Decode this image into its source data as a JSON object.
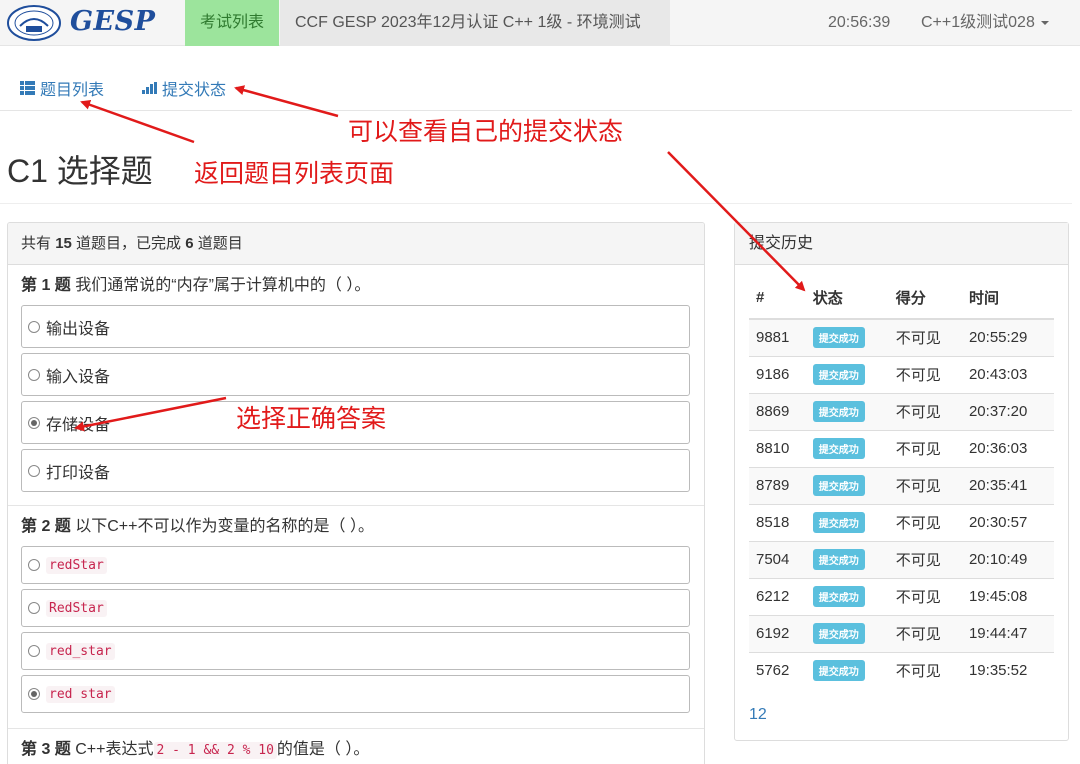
{
  "navbar": {
    "brand": "GESP",
    "exam_list": "考试列表",
    "exam_title": "CCF GESP 2023年12月认证 C++ 1级 - 环境测试",
    "clock": "20:56:39",
    "user": "C++1级测试028"
  },
  "subnav": {
    "problem_list": "题目列表",
    "submit_status": "提交状态"
  },
  "page_title": "C1 选择题",
  "left_panel": {
    "summary_prefix": "共有",
    "total": "15",
    "summary_mid": "道题目，已完成",
    "done": "6",
    "summary_suffix": "道题目"
  },
  "questions": [
    {
      "no_prefix": "第 1 题",
      "text": "我们通常说的“内存”属于计算机中的（ ）。",
      "options": [
        "输出设备",
        "输入设备",
        "存储设备",
        "打印设备"
      ],
      "selected": 2
    },
    {
      "no_prefix": "第 2 题",
      "text": "以下C++不可以作为变量的名称的是（ ）。",
      "options": [
        "redStar",
        "RedStar",
        "red_star",
        "red star"
      ],
      "selected": 3
    },
    {
      "no_prefix": "第 3 题",
      "text_before": "C++表达式",
      "code": "2 - 1 && 2 % 10",
      "text_after": "的值是（ ）。"
    }
  ],
  "history": {
    "title": "提交历史",
    "columns": [
      "#",
      "状态",
      "得分",
      "时间"
    ],
    "rows": [
      {
        "id": "9881",
        "status": "提交成功",
        "score": "不可见",
        "time": "20:55:29"
      },
      {
        "id": "9186",
        "status": "提交成功",
        "score": "不可见",
        "time": "20:43:03"
      },
      {
        "id": "8869",
        "status": "提交成功",
        "score": "不可见",
        "time": "20:37:20"
      },
      {
        "id": "8810",
        "status": "提交成功",
        "score": "不可见",
        "time": "20:36:03"
      },
      {
        "id": "8789",
        "status": "提交成功",
        "score": "不可见",
        "time": "20:35:41"
      },
      {
        "id": "8518",
        "status": "提交成功",
        "score": "不可见",
        "time": "20:30:57"
      },
      {
        "id": "7504",
        "status": "提交成功",
        "score": "不可见",
        "time": "20:10:49"
      },
      {
        "id": "6212",
        "status": "提交成功",
        "score": "不可见",
        "time": "19:45:08"
      },
      {
        "id": "6192",
        "status": "提交成功",
        "score": "不可见",
        "time": "19:44:47"
      },
      {
        "id": "5762",
        "status": "提交成功",
        "score": "不可见",
        "time": "19:35:52"
      }
    ],
    "pages": [
      "1",
      "2"
    ]
  },
  "annotations": {
    "view_status": "可以查看自己的提交状态",
    "back_to_list": "返回题目列表页面",
    "choose_answer": "选择正确答案"
  },
  "colors": {
    "annotation_red": "#e11a1a",
    "link_blue": "#337ab7",
    "nav_green": "#9ce49c",
    "badge_info": "#5bc0de",
    "brand_blue": "#1f4e9c"
  }
}
